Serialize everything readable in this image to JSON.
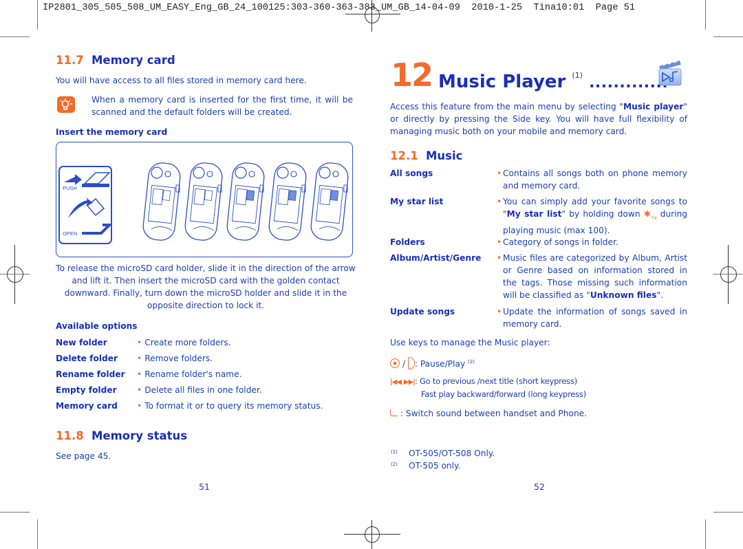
{
  "print_header": "IP2801_305_505_508_UM_EASY_Eng_GB_24_100125:303-360-363-383_UM_GB_14-04-09  2010-1-25  Tina10:01  Page 51",
  "colors": {
    "accent_orange": "#f26a2c",
    "text_blue": "#1a3fb0",
    "heading_blue": "#1a2fb5"
  },
  "left_page": {
    "section_memory_card": {
      "number": "11.7",
      "title": "Memory card",
      "intro": "You will have access to all files stored in memory card here.",
      "tip_icon": "lightbulb-icon",
      "tip_text": "When a memory card is inserted for the first time, it will be scanned and the default folders will be created.",
      "insert_heading": "Insert the memory card",
      "illustration": {
        "push_label": "PUSH",
        "open_label": "OPEN",
        "phone_steps": 5
      },
      "caption": "To release the microSD card holder, slide it in the direction of the arrow and lift it. Then insert the microSD card with the golden contact downward. Finally, turn down the microSD holder and slide it in the opposite direction to lock it.",
      "options_heading": "Available options",
      "options": [
        {
          "label": "New folder",
          "desc": "Create more folders."
        },
        {
          "label": "Delete folder",
          "desc": "Remove folders."
        },
        {
          "label": "Rename folder",
          "desc": "Rename folder's name."
        },
        {
          "label": "Empty folder",
          "desc": "Delete all files in one folder."
        },
        {
          "label": "Memory card",
          "desc": "To format it or to query its memory status."
        }
      ]
    },
    "section_memory_status": {
      "number": "11.8",
      "title": "Memory status",
      "text": "See page 45."
    },
    "page_number": "51"
  },
  "right_page": {
    "chapter": {
      "number": "12",
      "title": "Music Player",
      "footnote_ref": "(1)",
      "leader": ".............",
      "icon": "music-player-icon"
    },
    "intro": {
      "before": "Access this feature from the main menu by selecting \"",
      "bold": "Music player",
      "after": "\" or directly by pressing the Side key. You will have full flexibility of managing music both on your mobile and memory card."
    },
    "section_music": {
      "number": "12.1",
      "title": "Music",
      "items": [
        {
          "label": "All songs",
          "desc": "Contains all songs both on phone memory and memory card."
        },
        {
          "label": "My star list",
          "desc_before": "You can simply add your favorite songs to \"",
          "desc_bold": "My star list",
          "desc_after": "\" by holding down",
          "key_icon": "star-key-icon",
          "desc_after2": "during playing music (max 100)."
        },
        {
          "label": "Folders",
          "desc": "Category of songs in folder."
        },
        {
          "label": "Album/Artist/Genre",
          "desc_before": "Music files are categorized by Album, Artist or Genre based on information stored in the tags. Those missing such information will be classified as \"",
          "desc_bold": "Unknown files",
          "desc_after": "\"."
        },
        {
          "label": "Update songs",
          "desc": "Update the information of songs saved in memory card."
        }
      ]
    },
    "keys_intro": "Use keys to manage the Music player:",
    "keys": [
      {
        "icons": [
          "center-key-icon",
          "side-key-icon"
        ],
        "separator": "/",
        "text": ": Pause/Play",
        "footnote_ref": "(2)"
      },
      {
        "icons": [
          "previous-track-icon",
          "next-track-icon"
        ],
        "text": ": Go to previous /next title (short keypress)",
        "text2": "Fast play backward/forward (long keypress)"
      },
      {
        "icons": [
          "handsfree-key-icon"
        ],
        "text": ": Switch sound between handset and Phone."
      }
    ],
    "footnotes": [
      {
        "ref": "(1)",
        "text": "OT-505/OT-508 Only."
      },
      {
        "ref": "(2)",
        "text": "OT-505 only."
      }
    ],
    "page_number": "52"
  }
}
